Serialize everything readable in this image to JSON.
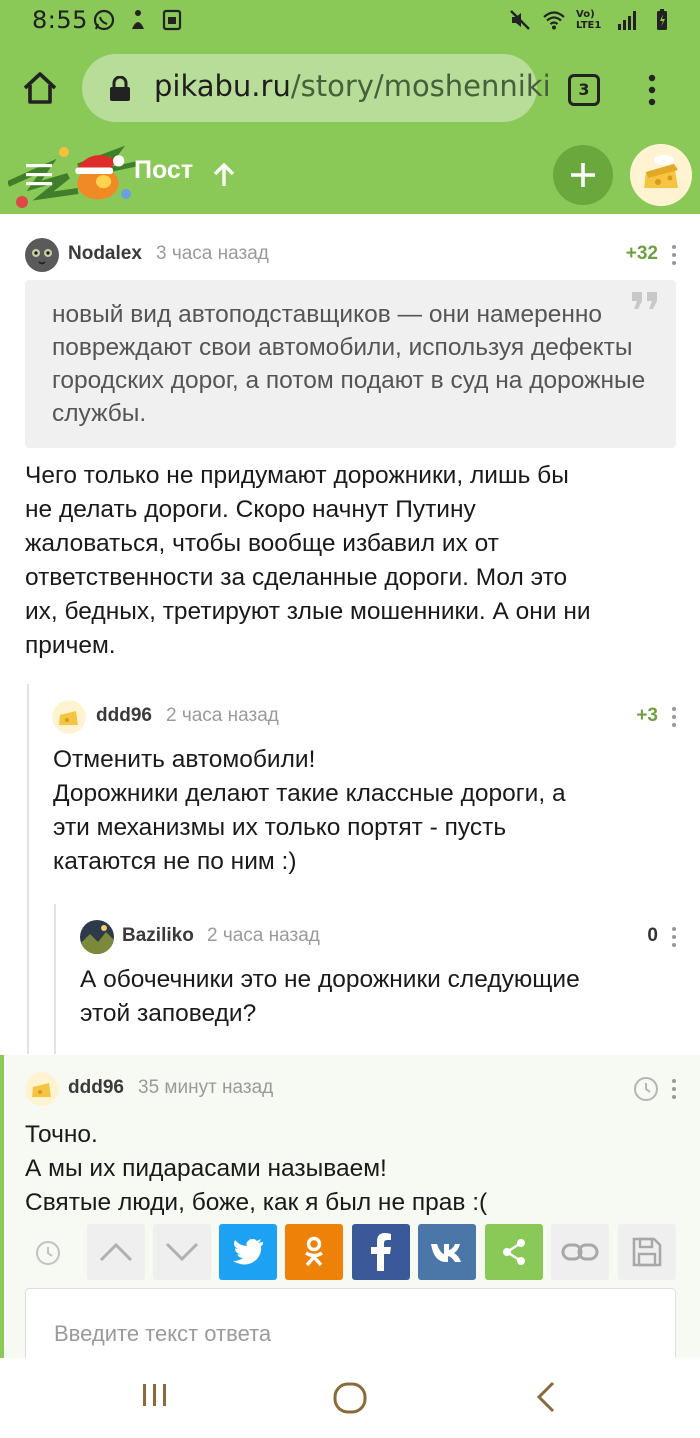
{
  "status_bar": {
    "time": "8:55",
    "network_label": "Vo) LTE1"
  },
  "browser": {
    "url_domain": "pikabu.ru",
    "url_path": "/story/moshenniki",
    "tab_count": "3"
  },
  "site_header": {
    "title": "Пост"
  },
  "comments": [
    {
      "author": "Nodalex",
      "time": "3 часа назад",
      "rating": "+32",
      "quote": "новый вид автоподставщиков — они намеренно повреждают свои автомобили, используя дефекты городских дорог, а потом подают в суд на дорожные службы.",
      "body_lines": [
        "Чего только не придумают дорожники, лишь бы",
        "не делать дороги. Скоро начнут Путину",
        "жаловаться, чтобы вообще избавил их от",
        "ответственности за сделанные дороги. Мол это",
        "их, бедных, третируют злые мошенники. А они ни",
        "причем."
      ]
    },
    {
      "author": "ddd96",
      "time": "2 часа назад",
      "rating": "+3",
      "body_lines": [
        "Отменить автомобили!",
        "Дорожники делают такие классные дороги, а",
        "эти механизмы их только портят - пусть",
        "катаются не по ним :)"
      ]
    },
    {
      "author": "Baziliko",
      "time": "2 часа назад",
      "rating": "0",
      "body_lines": [
        "А обочечники это не дорожники следующие",
        "этой заповеди?"
      ]
    },
    {
      "author": "ddd96",
      "time": "35 минут назад",
      "body_lines": [
        "Точно.",
        "А мы их пидарасами называем!",
        "Святые люди, боже, как я был не прав :("
      ]
    }
  ],
  "actions": {
    "colors": {
      "twitter": "#1da1f2",
      "odnoklassniki": "#ee8208",
      "facebook": "#3b5998",
      "vk": "#4a76a8",
      "share": "#8ac858",
      "neutral": "#efefef"
    }
  },
  "reply": {
    "placeholder": "Введите текст ответа"
  },
  "theme": {
    "accent": "#8ac858"
  }
}
